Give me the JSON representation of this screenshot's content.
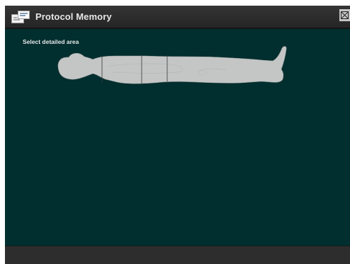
{
  "window": {
    "title": "Protocol Memory",
    "icon": "protocol-memory-icon",
    "close_icon": "close-icon"
  },
  "content": {
    "instruction": "Select detailed area",
    "figure": "body-outline-supine"
  },
  "colors": {
    "titlebar": "#2c2c2c",
    "content_bg": "#012e2e",
    "body_fill": "#c4c6c6",
    "text": "#e6e6e6"
  }
}
